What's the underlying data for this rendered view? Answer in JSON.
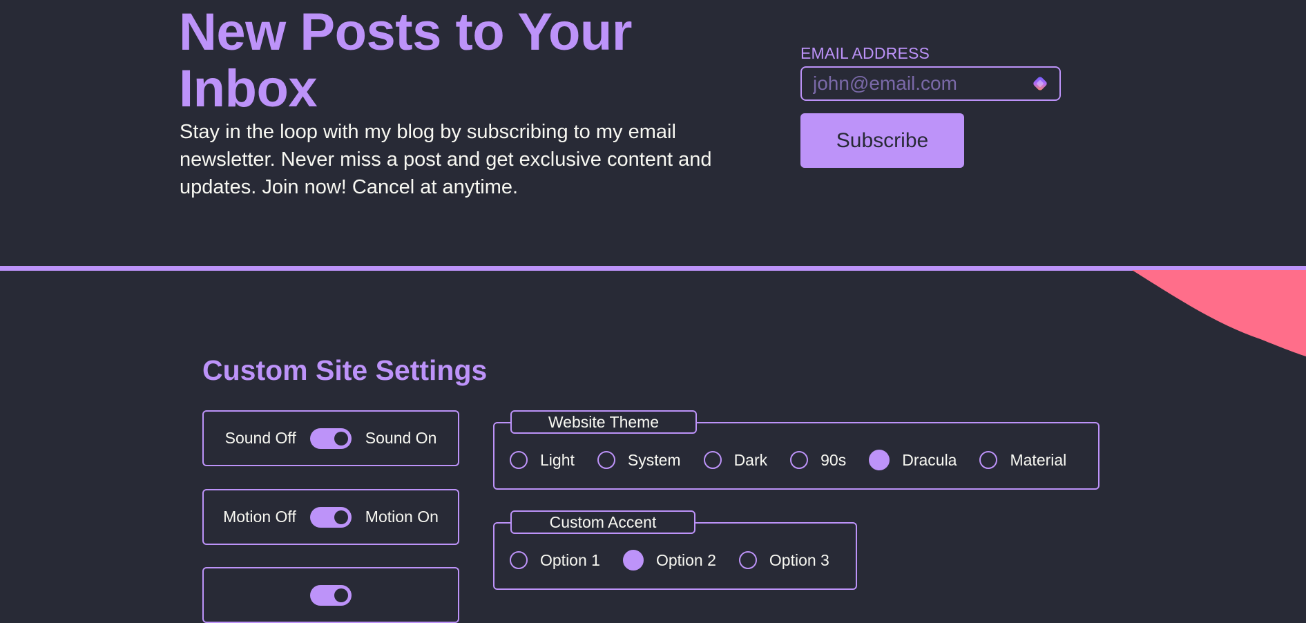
{
  "colors": {
    "background": "#282a36",
    "accent": "#bd93f9",
    "text": "#f8f8f2",
    "placeholder": "#7a69a8",
    "blob": "#ff6e8a"
  },
  "newsletter": {
    "title": "New Posts to Your Inbox",
    "description": "Stay in the loop with my blog by subscribing to my email newsletter. Never miss a post and get exclusive content and updates. Join now! Cancel at anytime.",
    "email_label": "EMAIL ADDRESS",
    "email_placeholder": "john@email.com",
    "email_value": "",
    "field_icon": "password-manager-icon",
    "subscribe_label": "Subscribe"
  },
  "settings": {
    "title": "Custom Site Settings",
    "toggles": [
      {
        "off_label": "Sound Off",
        "on_label": "Sound On",
        "state": "on"
      },
      {
        "off_label": "Motion Off",
        "on_label": "Motion On",
        "state": "on"
      }
    ],
    "theme": {
      "legend": "Website Theme",
      "options": [
        "Light",
        "System",
        "Dark",
        "90s",
        "Dracula",
        "Material"
      ],
      "selected": "Dracula"
    },
    "accent": {
      "legend": "Custom Accent",
      "options": [
        "Option 1",
        "Option 2",
        "Option 3"
      ],
      "selected": "Option 2"
    }
  }
}
